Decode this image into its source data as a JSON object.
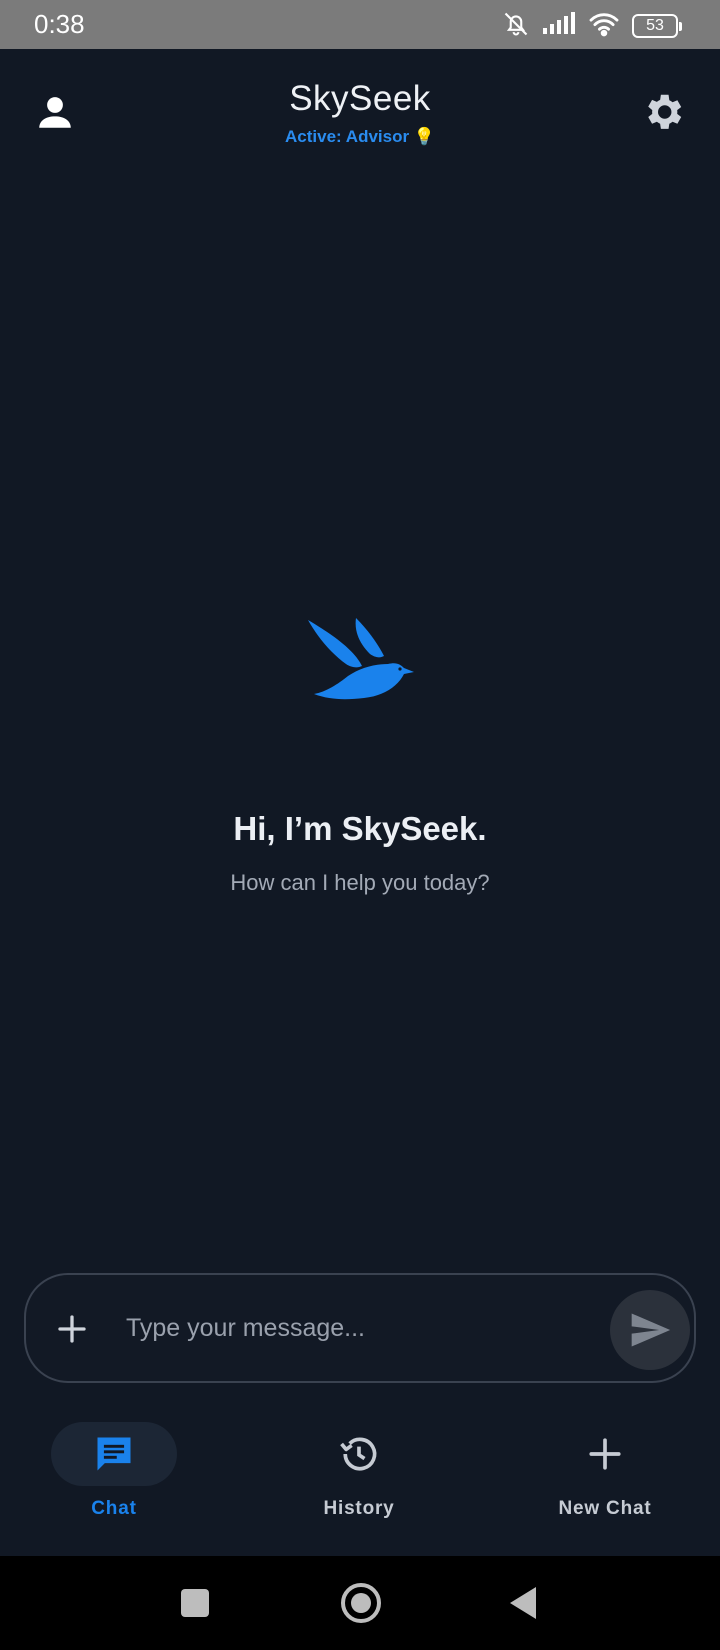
{
  "status_bar": {
    "time": "0:38",
    "battery": "53",
    "icons": [
      "bell-off-icon",
      "signal-icon",
      "wifi-icon",
      "battery-icon"
    ]
  },
  "header": {
    "title": "SkySeek",
    "active_label": "Active: Advisor 💡",
    "icons": [
      "profile-icon",
      "settings-gear-icon"
    ]
  },
  "main": {
    "logo_icon": "bird-logo-icon",
    "greeting": "Hi, I’m SkySeek.",
    "subtitle": "How can I help you today?"
  },
  "composer": {
    "placeholder": "Type your message...",
    "value": "",
    "attach_icon": "plus-icon",
    "send_icon": "send-icon"
  },
  "bottom_nav": {
    "items": [
      {
        "label": "Chat",
        "icon": "chat-icon",
        "active": true
      },
      {
        "label": "History",
        "icon": "history-icon",
        "active": false
      },
      {
        "label": "New Chat",
        "icon": "plus-icon",
        "active": false
      }
    ]
  },
  "system_nav": {
    "icons": [
      "recents-square-icon",
      "home-circle-icon",
      "back-triangle-icon"
    ]
  },
  "colors": {
    "background": "#111824",
    "accent": "#1a82ec",
    "muted_text": "#a3aab6",
    "status_bar": "#7b7b7b"
  }
}
